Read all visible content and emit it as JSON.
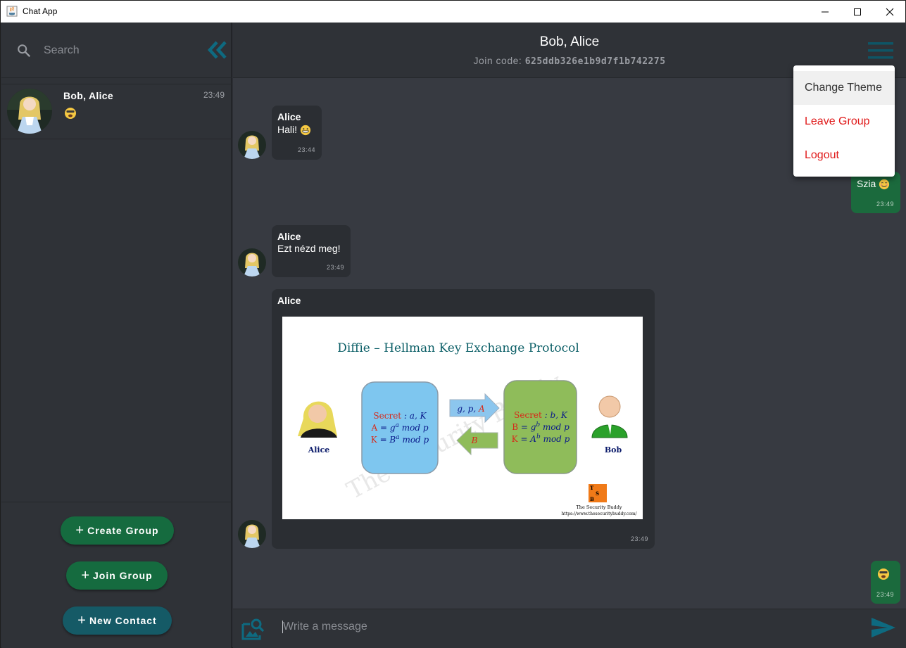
{
  "window": {
    "title": "Chat App"
  },
  "sidebar": {
    "search_placeholder": "Search",
    "chats": [
      {
        "name": "Bob, Alice",
        "time": "23:49",
        "preview": "emoji-face"
      }
    ],
    "buttons": {
      "create_group": "Create Group",
      "join_group": "Join Group",
      "new_contact": "New Contact"
    }
  },
  "header": {
    "title": "Bob, Alice",
    "join_label": "Join code:",
    "join_code": "625ddb326e1b9d7f1b742275"
  },
  "menu": {
    "change_theme": "Change Theme",
    "leave_group": "Leave Group",
    "logout": "Logout"
  },
  "messages": [
    {
      "sender": "Alice",
      "text": "Hali!",
      "time": "23:44",
      "direction": "in"
    },
    {
      "sender": "",
      "text": "Szia",
      "time": "23:49",
      "direction": "out"
    },
    {
      "sender": "Alice",
      "text": "Ezt nézd meg!",
      "time": "23:49",
      "direction": "in"
    },
    {
      "sender": "Alice",
      "image": "diffie-hellman-diagram",
      "time": "23:49",
      "direction": "in"
    },
    {
      "sender": "",
      "text": "",
      "time": "23:49",
      "direction": "out"
    }
  ],
  "image_content": {
    "title": "Diffie – Hellman Key Exchange Protocol",
    "alice_label": "Alice",
    "bob_label": "Bob",
    "left_box": {
      "line1_label": "Secret",
      "line1_value": ": a, K",
      "line2_var": "A",
      "line2_rest": "= g",
      "line2_sup": "a",
      "line2_mod": "mod p",
      "line3_var": "K",
      "line3_rest": "= B",
      "line3_sup": "a",
      "line3_mod": "mod p"
    },
    "right_box": {
      "line1_label": "Secret",
      "line1_value": ": b, K",
      "line2_var": "B",
      "line2_rest": "= g",
      "line2_sup": "b",
      "line2_mod": "mod p",
      "line3_var": "K",
      "line3_rest": "= A",
      "line3_sup": "b",
      "line3_mod": "mod p"
    },
    "arrow_right_prefix": "g, p,",
    "arrow_right_var": "A",
    "arrow_left": "B",
    "watermark": "The Security Buddy",
    "logo_letters": [
      "T",
      "S",
      "B"
    ],
    "brand_line1": "The Security Buddy",
    "brand_line2": "https://www.thesecuritybuddy.com/"
  },
  "input": {
    "placeholder": "Write a message"
  },
  "colors": {
    "accent_teal": "#0e5566",
    "green_button": "#156b3f",
    "teal_button": "#155a66",
    "danger_red": "#e01a1a",
    "outgoing_bubble": "#1b6a3d",
    "incoming_bubble": "#2b2e33"
  },
  "icons": [
    "java-app-icon",
    "minimize-icon",
    "maximize-icon",
    "close-icon",
    "search-icon",
    "collapse-chevrons-icon",
    "hamburger-menu-icon",
    "attach-image-icon",
    "send-icon"
  ]
}
